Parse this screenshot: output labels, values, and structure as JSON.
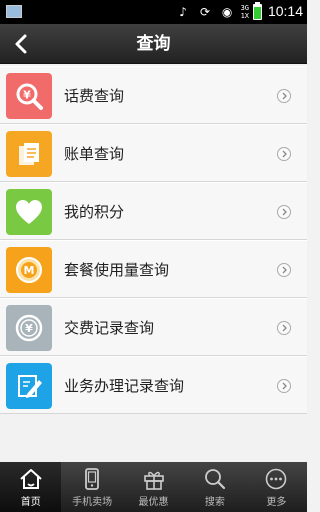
{
  "status_bar": {
    "network": [
      "3G",
      "1X"
    ],
    "time": "10:14",
    "battery_level": 0.85
  },
  "header": {
    "title": "查询"
  },
  "menu": [
    {
      "label": "话费查询",
      "icon": "search-yuan-icon",
      "color": "#f26b6b"
    },
    {
      "label": "账单查询",
      "icon": "document-icon",
      "color": "#f5a623"
    },
    {
      "label": "我的积分",
      "icon": "heart-icon",
      "color": "#7ac943"
    },
    {
      "label": "套餐使用量查询",
      "icon": "m-coin-icon",
      "color": "#f7a21b"
    },
    {
      "label": "交费记录查询",
      "icon": "yuan-coin-icon",
      "color": "#a9b3ba"
    },
    {
      "label": "业务办理记录查询",
      "icon": "edit-icon",
      "color": "#1ea3e6"
    }
  ],
  "tabs": [
    {
      "label": "首页",
      "icon": "home-icon",
      "active": true
    },
    {
      "label": "手机卖场",
      "icon": "phone-icon",
      "active": false
    },
    {
      "label": "最优惠",
      "icon": "gift-icon",
      "active": false
    },
    {
      "label": "搜索",
      "icon": "search-icon",
      "active": false
    },
    {
      "label": "更多",
      "icon": "more-icon",
      "active": false
    }
  ]
}
